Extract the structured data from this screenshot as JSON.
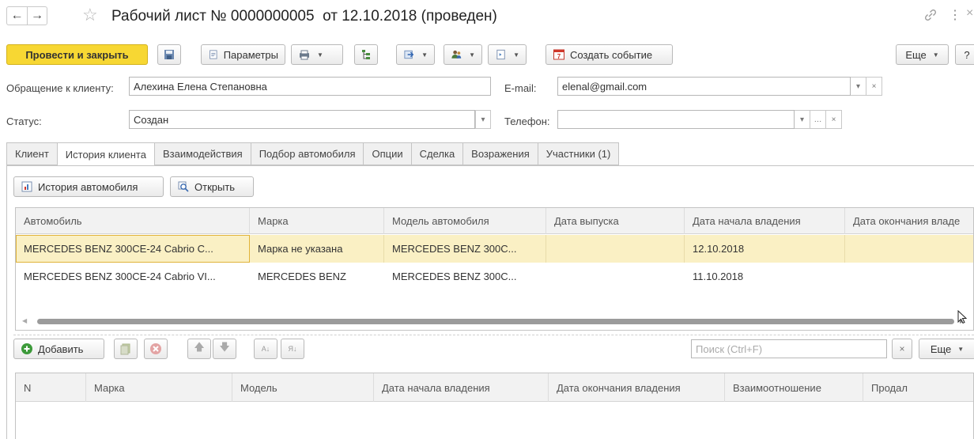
{
  "window": {
    "title": "Рабочий лист № 0000000005  от 12.10.2018 (проведен)",
    "nav_back": "←",
    "nav_forward": "→",
    "star": "☆",
    "link_icon": "🔗",
    "more_icon": "⋮",
    "close_icon": "×"
  },
  "toolbar": {
    "post_close": "Провести и закрыть",
    "parameters": "Параметры",
    "create_event": "Создать событие",
    "more": "Еще",
    "help": "?"
  },
  "form": {
    "client_label": "Обращение к клиенту:",
    "client_value": "Алехина Елена Степановна",
    "email_label": "E-mail:",
    "email_value": "elenal@gmail.com",
    "status_label": "Статус:",
    "status_value": "Создан",
    "phone_label": "Телефон:",
    "phone_value": ""
  },
  "tabs": [
    {
      "label": "Клиент"
    },
    {
      "label": "История клиента"
    },
    {
      "label": "Взаимодействия"
    },
    {
      "label": "Подбор автомобиля"
    },
    {
      "label": "Опции"
    },
    {
      "label": "Сделка"
    },
    {
      "label": "Возражения"
    },
    {
      "label": "Участники (1)"
    }
  ],
  "car_history": {
    "history_button": "История автомобиля",
    "open_button": "Открыть",
    "columns": [
      "Автомобиль",
      "Марка",
      "Модель автомобиля",
      "Дата выпуска",
      "Дата начала владения",
      "Дата окончания владе"
    ],
    "rows": [
      [
        "MERCEDES BENZ 300CE-24 Cabrio C...",
        "Марка не указана",
        "MERCEDES BENZ 300C...",
        "",
        "12.10.2018",
        ""
      ],
      [
        "MERCEDES BENZ 300CE-24 Cabrio VI...",
        "MERCEDES BENZ",
        "MERCEDES BENZ 300C...",
        "",
        "11.10.2018",
        ""
      ]
    ]
  },
  "ownership": {
    "add_button": "Добавить",
    "search_placeholder": "Поиск (Ctrl+F)",
    "more": "Еще",
    "columns": [
      "N",
      "Марка",
      "Модель",
      "Дата начала владения",
      "Дата окончания владения",
      "Взаимоотношение",
      "Продал"
    ]
  },
  "colors": {
    "primary_button": "#f7d733",
    "selected_row": "#faf0c4",
    "accent_red": "#d0382b"
  }
}
